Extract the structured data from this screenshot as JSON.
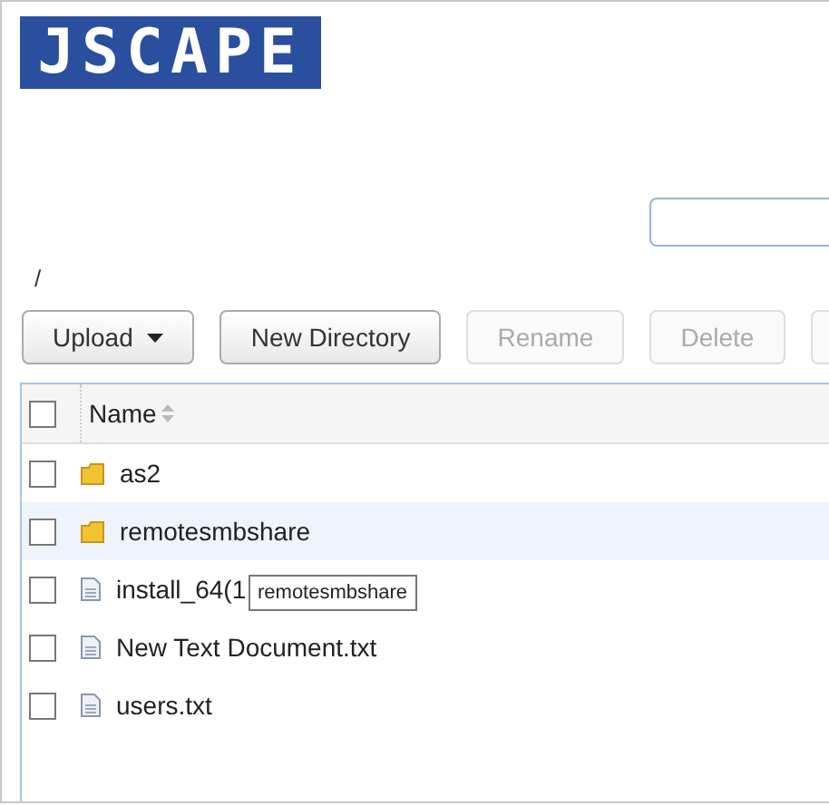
{
  "logo": {
    "text": "JSCAPE"
  },
  "path": "/",
  "toolbar": [
    {
      "label": "Upload",
      "kind": "dropdown",
      "disabled": false
    },
    {
      "label": "New Directory",
      "kind": "button",
      "disabled": false
    },
    {
      "label": "Rename",
      "kind": "button",
      "disabled": true
    },
    {
      "label": "Delete",
      "kind": "button",
      "disabled": true
    },
    {
      "kind": "button",
      "disabled": true
    }
  ],
  "table": {
    "header": {
      "label": "Name",
      "checked": false
    },
    "rows": [
      {
        "name": "as2",
        "kind": "folder",
        "checked": false,
        "hovered": false
      },
      {
        "name": "remotesmbshare",
        "kind": "folder",
        "checked": false,
        "hovered": true
      },
      {
        "name": "install_64(1",
        "kind": "file",
        "checked": false,
        "hovered": false
      },
      {
        "name": "New Text Document.txt",
        "kind": "file",
        "checked": false,
        "hovered": false
      },
      {
        "name": "users.txt",
        "kind": "file",
        "checked": false,
        "hovered": false
      }
    ]
  },
  "tooltip": {
    "text": "remotesmbshare"
  }
}
